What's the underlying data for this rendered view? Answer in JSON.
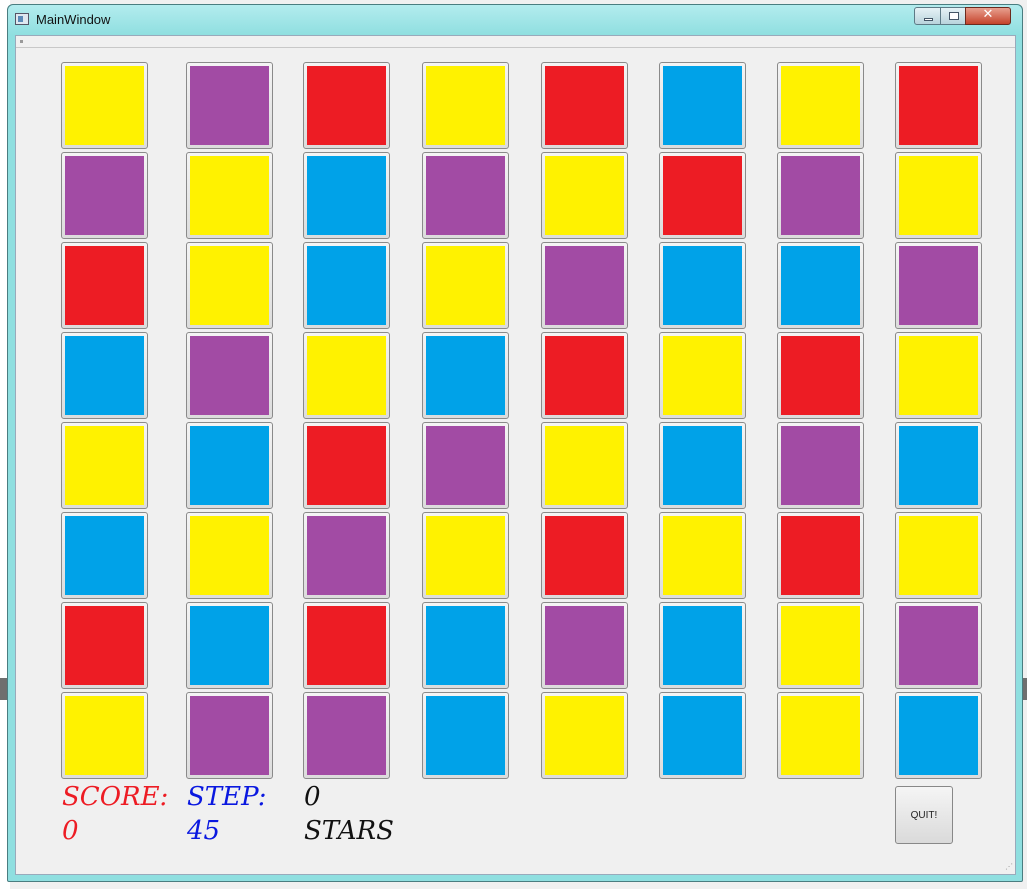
{
  "window": {
    "title": "MainWindow",
    "close_glyph": "✕"
  },
  "colors": {
    "yellow": "#fff200",
    "purple": "#a24ba4",
    "red": "#ed1c24",
    "blue": "#00a2e8",
    "score": "#ed1c24",
    "step": "#0a18e0",
    "stars": "#111111"
  },
  "board": [
    [
      "yellow",
      "purple",
      "red",
      "yellow",
      "red",
      "blue",
      "yellow",
      "red"
    ],
    [
      "purple",
      "yellow",
      "blue",
      "purple",
      "yellow",
      "red",
      "purple",
      "yellow"
    ],
    [
      "red",
      "yellow",
      "blue",
      "yellow",
      "purple",
      "blue",
      "blue",
      "purple"
    ],
    [
      "blue",
      "purple",
      "yellow",
      "blue",
      "red",
      "yellow",
      "red",
      "yellow"
    ],
    [
      "yellow",
      "blue",
      "red",
      "purple",
      "yellow",
      "blue",
      "purple",
      "blue"
    ],
    [
      "blue",
      "yellow",
      "purple",
      "yellow",
      "red",
      "yellow",
      "red",
      "yellow"
    ],
    [
      "red",
      "blue",
      "red",
      "blue",
      "purple",
      "blue",
      "yellow",
      "purple"
    ],
    [
      "yellow",
      "purple",
      "purple",
      "blue",
      "yellow",
      "blue",
      "yellow",
      "blue"
    ]
  ],
  "status": {
    "score_label": "SCORE:",
    "score_value": "0",
    "step_label": "STEP:",
    "step_value": "45",
    "stars_value": "0",
    "stars_label": "STARS"
  },
  "quit_label": "QUIT!"
}
